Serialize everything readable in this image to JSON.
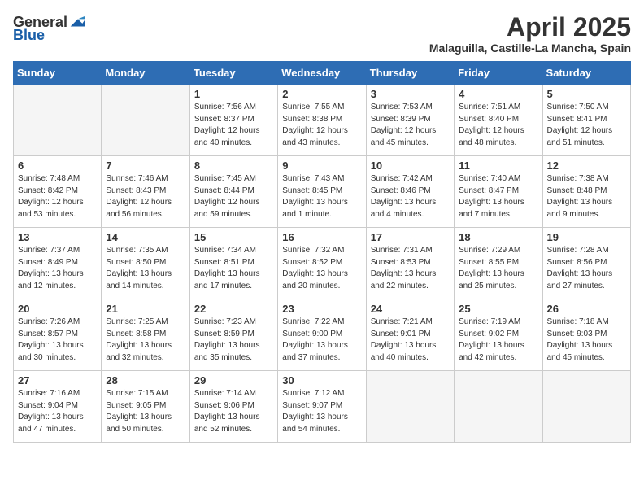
{
  "logo": {
    "general": "General",
    "blue": "Blue"
  },
  "title": "April 2025",
  "subtitle": "Malaguilla, Castille-La Mancha, Spain",
  "days_of_week": [
    "Sunday",
    "Monday",
    "Tuesday",
    "Wednesday",
    "Thursday",
    "Friday",
    "Saturday"
  ],
  "weeks": [
    [
      {
        "num": "",
        "info": ""
      },
      {
        "num": "",
        "info": ""
      },
      {
        "num": "1",
        "info": "Sunrise: 7:56 AM\nSunset: 8:37 PM\nDaylight: 12 hours and 40 minutes."
      },
      {
        "num": "2",
        "info": "Sunrise: 7:55 AM\nSunset: 8:38 PM\nDaylight: 12 hours and 43 minutes."
      },
      {
        "num": "3",
        "info": "Sunrise: 7:53 AM\nSunset: 8:39 PM\nDaylight: 12 hours and 45 minutes."
      },
      {
        "num": "4",
        "info": "Sunrise: 7:51 AM\nSunset: 8:40 PM\nDaylight: 12 hours and 48 minutes."
      },
      {
        "num": "5",
        "info": "Sunrise: 7:50 AM\nSunset: 8:41 PM\nDaylight: 12 hours and 51 minutes."
      }
    ],
    [
      {
        "num": "6",
        "info": "Sunrise: 7:48 AM\nSunset: 8:42 PM\nDaylight: 12 hours and 53 minutes."
      },
      {
        "num": "7",
        "info": "Sunrise: 7:46 AM\nSunset: 8:43 PM\nDaylight: 12 hours and 56 minutes."
      },
      {
        "num": "8",
        "info": "Sunrise: 7:45 AM\nSunset: 8:44 PM\nDaylight: 12 hours and 59 minutes."
      },
      {
        "num": "9",
        "info": "Sunrise: 7:43 AM\nSunset: 8:45 PM\nDaylight: 13 hours and 1 minute."
      },
      {
        "num": "10",
        "info": "Sunrise: 7:42 AM\nSunset: 8:46 PM\nDaylight: 13 hours and 4 minutes."
      },
      {
        "num": "11",
        "info": "Sunrise: 7:40 AM\nSunset: 8:47 PM\nDaylight: 13 hours and 7 minutes."
      },
      {
        "num": "12",
        "info": "Sunrise: 7:38 AM\nSunset: 8:48 PM\nDaylight: 13 hours and 9 minutes."
      }
    ],
    [
      {
        "num": "13",
        "info": "Sunrise: 7:37 AM\nSunset: 8:49 PM\nDaylight: 13 hours and 12 minutes."
      },
      {
        "num": "14",
        "info": "Sunrise: 7:35 AM\nSunset: 8:50 PM\nDaylight: 13 hours and 14 minutes."
      },
      {
        "num": "15",
        "info": "Sunrise: 7:34 AM\nSunset: 8:51 PM\nDaylight: 13 hours and 17 minutes."
      },
      {
        "num": "16",
        "info": "Sunrise: 7:32 AM\nSunset: 8:52 PM\nDaylight: 13 hours and 20 minutes."
      },
      {
        "num": "17",
        "info": "Sunrise: 7:31 AM\nSunset: 8:53 PM\nDaylight: 13 hours and 22 minutes."
      },
      {
        "num": "18",
        "info": "Sunrise: 7:29 AM\nSunset: 8:55 PM\nDaylight: 13 hours and 25 minutes."
      },
      {
        "num": "19",
        "info": "Sunrise: 7:28 AM\nSunset: 8:56 PM\nDaylight: 13 hours and 27 minutes."
      }
    ],
    [
      {
        "num": "20",
        "info": "Sunrise: 7:26 AM\nSunset: 8:57 PM\nDaylight: 13 hours and 30 minutes."
      },
      {
        "num": "21",
        "info": "Sunrise: 7:25 AM\nSunset: 8:58 PM\nDaylight: 13 hours and 32 minutes."
      },
      {
        "num": "22",
        "info": "Sunrise: 7:23 AM\nSunset: 8:59 PM\nDaylight: 13 hours and 35 minutes."
      },
      {
        "num": "23",
        "info": "Sunrise: 7:22 AM\nSunset: 9:00 PM\nDaylight: 13 hours and 37 minutes."
      },
      {
        "num": "24",
        "info": "Sunrise: 7:21 AM\nSunset: 9:01 PM\nDaylight: 13 hours and 40 minutes."
      },
      {
        "num": "25",
        "info": "Sunrise: 7:19 AM\nSunset: 9:02 PM\nDaylight: 13 hours and 42 minutes."
      },
      {
        "num": "26",
        "info": "Sunrise: 7:18 AM\nSunset: 9:03 PM\nDaylight: 13 hours and 45 minutes."
      }
    ],
    [
      {
        "num": "27",
        "info": "Sunrise: 7:16 AM\nSunset: 9:04 PM\nDaylight: 13 hours and 47 minutes."
      },
      {
        "num": "28",
        "info": "Sunrise: 7:15 AM\nSunset: 9:05 PM\nDaylight: 13 hours and 50 minutes."
      },
      {
        "num": "29",
        "info": "Sunrise: 7:14 AM\nSunset: 9:06 PM\nDaylight: 13 hours and 52 minutes."
      },
      {
        "num": "30",
        "info": "Sunrise: 7:12 AM\nSunset: 9:07 PM\nDaylight: 13 hours and 54 minutes."
      },
      {
        "num": "",
        "info": ""
      },
      {
        "num": "",
        "info": ""
      },
      {
        "num": "",
        "info": ""
      }
    ]
  ]
}
